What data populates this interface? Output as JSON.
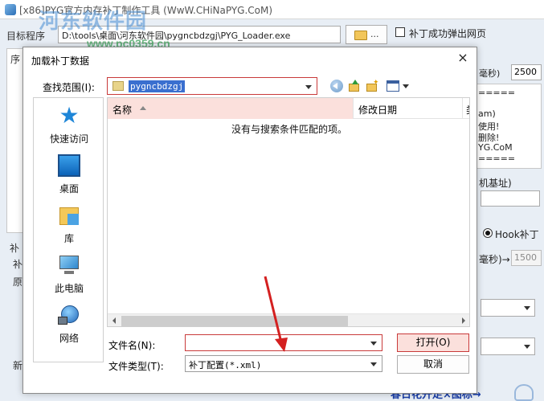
{
  "main_window": {
    "title": "[x86]PYG官方内存补丁制作工具 (WwW.CHiNaPYG.CoM)",
    "program_label": "目标程序",
    "program_path": "D:\\tools\\桌面\\河东软件园\\pygncbdzgj\\PYG_Loader.exe",
    "browse_label": "...",
    "popup_checkbox_label": "补丁成功弹出网页",
    "seq_label": "序",
    "side_labels": [
      "补",
      "补",
      "原",
      "新"
    ],
    "right_fragments": {
      "ms_label": "毫秒)",
      "delay_value": "2500",
      "info_lines": [
        "=====",
        "am)",
        "使用!",
        "删除!",
        "YG.CoM",
        "====="
      ],
      "base_label": "机基址)",
      "hook_label": "Hook补丁",
      "ms_label2": "毫秒)→",
      "delay_value2": "1500"
    },
    "bottom_banner": "春日花开走×图标→"
  },
  "watermark": {
    "text": "河东软件园",
    "url": "www.pc0359.cn"
  },
  "dialog": {
    "title": "加载补丁数据",
    "close_glyph": "×",
    "lookin_label": "查找范围(I):",
    "lookin_value": "pygncbdzgj",
    "places": [
      {
        "label": "快速访问",
        "icon": "star-icon"
      },
      {
        "label": "桌面",
        "icon": "desktop-icon"
      },
      {
        "label": "库",
        "icon": "library-icon"
      },
      {
        "label": "此电脑",
        "icon": "computer-icon"
      },
      {
        "label": "网络",
        "icon": "network-icon"
      }
    ],
    "columns": {
      "name": "名称",
      "date": "修改日期",
      "more": "类"
    },
    "empty_message": "没有与搜索条件匹配的项。",
    "filename_label": "文件名(N):",
    "filename_value": "",
    "filetype_label": "文件类型(T):",
    "filetype_value": "补丁配置(*.xml)",
    "open_label": "打开(O)",
    "cancel_label": "取消"
  },
  "colors": {
    "highlight_border": "#c93a3a",
    "selection": "#3a6fcf",
    "header_highlight": "#fbe0dc",
    "annotation_arrow": "#d42020"
  }
}
